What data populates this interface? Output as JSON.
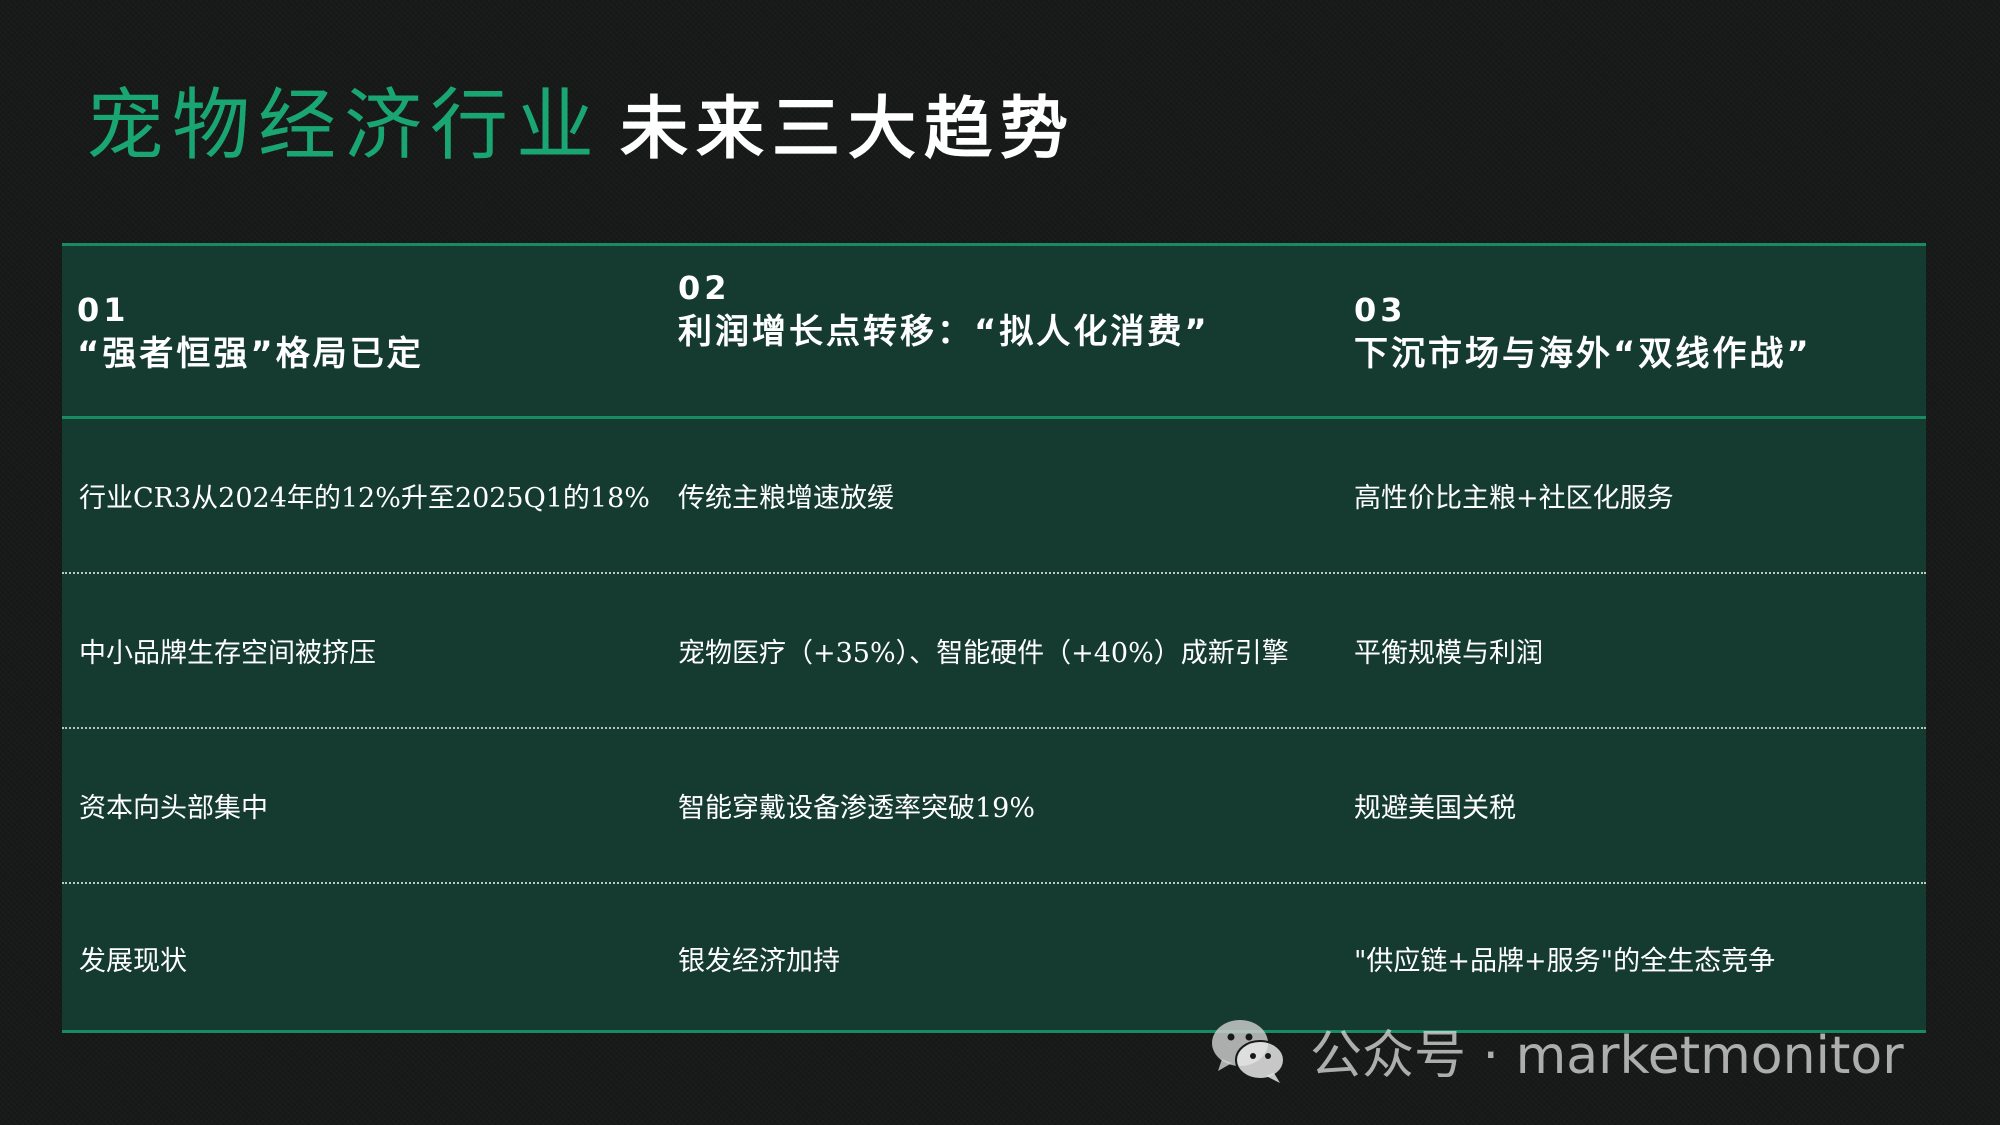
{
  "title": {
    "main": "宠物经济行业",
    "sub": "未来三大趋势"
  },
  "table": {
    "headers": [
      {
        "num": "01",
        "text": "“强者恒强”格局已定"
      },
      {
        "num": "02",
        "text": "利润增长点转移：“拟人化消费”"
      },
      {
        "num": "03",
        "text": "下沉市场与海外“双线作战”"
      }
    ],
    "rows": [
      [
        "行业CR3从2024年的12%升至2025Q1的18%",
        "传统主粮增速放缓",
        "高性价比主粮+社区化服务"
      ],
      [
        "中小品牌生存空间被挤压",
        "宠物医疗（+35%）、智能硬件（+40%）成新引擎",
        "平衡规模与利润"
      ],
      [
        "资本向头部集中",
        "智能穿戴设备渗透率突破19%",
        "规避美国关税"
      ],
      [
        "发展现状",
        "银发经济加持",
        "\"供应链+品牌+服务\"的全生态竞争"
      ]
    ]
  },
  "watermark": {
    "icon": "wechat-icon",
    "text": "公众号 · marketmonitor"
  },
  "colors": {
    "accent": "#1aa673",
    "table_bg": "#153b31",
    "border": "#1a8a62",
    "background": "#181a19"
  }
}
